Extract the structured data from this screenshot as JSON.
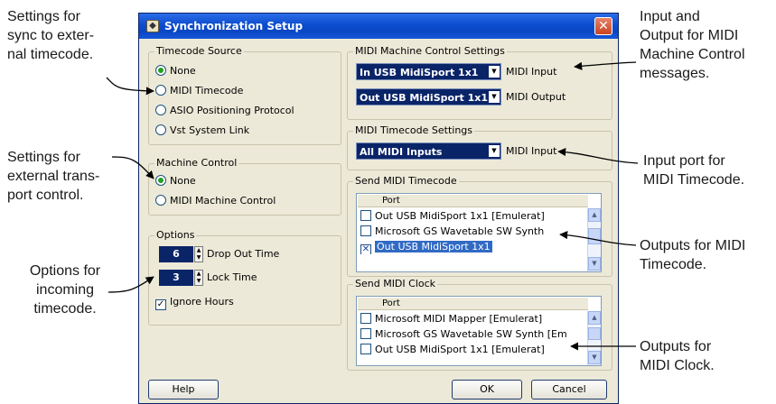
{
  "annotations": {
    "sync_settings": "Settings for\nsync to exter-\nnal timecode.",
    "transport_settings": "Settings for\nexternal trans-\nport control.",
    "options_incoming": "Options for\nincoming\ntimecode.",
    "mmc_io": "Input and\nOutput for MIDI\nMachine Control\nmessages.",
    "mtc_input_port": "Input port for\nMIDI Timecode.",
    "mtc_outputs": "Outputs for MIDI\nTimecode.",
    "clock_outputs": "Outputs for\nMIDI Clock."
  },
  "window": {
    "title": "Synchronization Setup",
    "close_glyph": "✕"
  },
  "timecode_source": {
    "title": "Timecode Source",
    "options": [
      "None",
      "MIDI Timecode",
      "ASIO Positioning Protocol",
      "Vst System Link"
    ],
    "selected": "None"
  },
  "machine_control": {
    "title": "Machine Control",
    "options": [
      "None",
      "MIDI Machine Control"
    ],
    "selected": "None"
  },
  "options": {
    "title": "Options",
    "drop_out_value": "6",
    "drop_out_label": "Drop Out Time",
    "lock_value": "3",
    "lock_label": "Lock Time",
    "ignore_hours_label": "Ignore Hours",
    "ignore_hours_checked": true
  },
  "mmc_settings": {
    "title": "MIDI Machine Control Settings",
    "input_value": "In USB MidiSport 1x1",
    "input_label": "MIDI Input",
    "output_value": "Out USB MidiSport 1x1",
    "output_label": "MIDI Output"
  },
  "mtc_settings": {
    "title": "MIDI Timecode Settings",
    "input_value": "All MIDI Inputs",
    "input_label": "MIDI Input"
  },
  "send_mtc": {
    "title": "Send MIDI Timecode",
    "column": "Port",
    "rows": [
      {
        "label": "Out USB MidiSport 1x1 [Emulerat]",
        "checked": false
      },
      {
        "label": "Microsoft GS Wavetable SW Synth",
        "checked": false
      },
      {
        "label": "Out USB MidiSport 1x1",
        "checked": true
      }
    ]
  },
  "send_clock": {
    "title": "Send MIDI Clock",
    "column": "Port",
    "rows": [
      {
        "label": "Microsoft MIDI Mapper [Emulerat]",
        "checked": false
      },
      {
        "label": "Microsoft GS Wavetable SW Synth [Em",
        "checked": false
      },
      {
        "label": "Out USB MidiSport 1x1 [Emulerat]",
        "checked": false
      }
    ]
  },
  "buttons": {
    "help": "Help",
    "ok": "OK",
    "cancel": "Cancel"
  },
  "colors": {
    "dialog_bg": "#ece9d8",
    "titlebar": "#0b4ccf",
    "field_bg": "#0a2468",
    "selection": "#316ac5"
  }
}
